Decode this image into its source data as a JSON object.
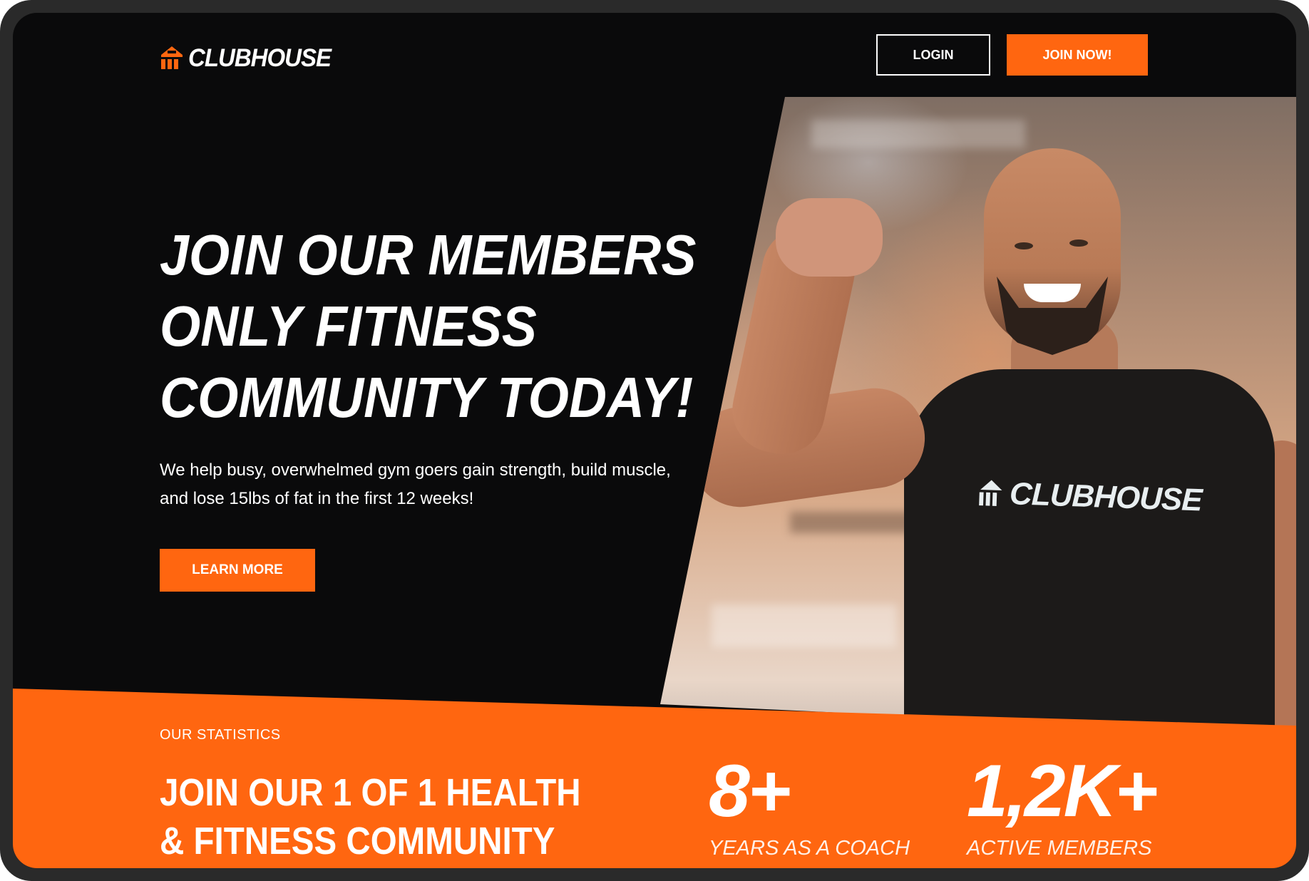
{
  "header": {
    "logo_text": "CLUBHOUSE",
    "login_label": "LOGIN",
    "join_label": "JOIN NOW!"
  },
  "hero": {
    "title_lines": [
      "JOIN OUR MEMBERS",
      "ONLY FITNESS",
      "COMMUNITY TODAY!"
    ],
    "subtitle": "We help busy, overwhelmed gym goers gain strength, build muscle, and lose 15lbs of fat in the first 12 weeks!",
    "cta_label": "LEARN MORE",
    "photo": {
      "shirt_text": "CLUBHOUSE"
    }
  },
  "stats": {
    "label": "OUR STATISTICS",
    "title_lines": [
      "JOIN OUR 1 OF 1 HEALTH",
      "& FITNESS COMMUNITY"
    ],
    "items": [
      {
        "value": "8+",
        "label": "YEARS AS A COACH"
      },
      {
        "value": "1,2K+",
        "label": "ACTIVE MEMBERS"
      }
    ]
  },
  "colors": {
    "accent": "#ff6610",
    "background": "#0a0a0b",
    "text": "#ffffff"
  },
  "icons": {
    "logo": "clubhouse-logo-icon"
  }
}
